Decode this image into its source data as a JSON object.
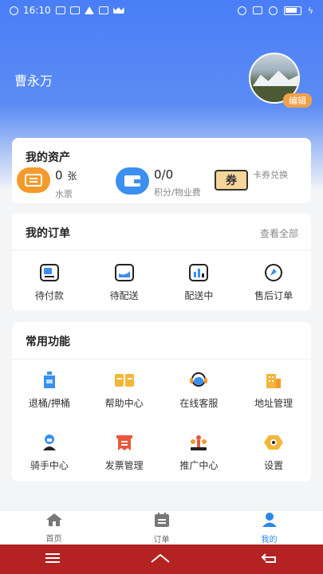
{
  "status_bar": {
    "time": "16:10",
    "battery_level": 0.7
  },
  "profile": {
    "name": "曹永万",
    "edit_label": "编辑"
  },
  "assets": {
    "title": "我的资产",
    "water": {
      "value": "0",
      "unit": "张",
      "label": "水票"
    },
    "points": {
      "value": "0/0",
      "label": "积分/物业费"
    },
    "coupon": {
      "glyph": "券",
      "label": "卡券兑换"
    }
  },
  "orders": {
    "title": "我的订单",
    "view_all": "查看全部",
    "items": [
      {
        "label": "待付款",
        "icon": "pending-payment-icon"
      },
      {
        "label": "待配送",
        "icon": "pending-delivery-icon"
      },
      {
        "label": "配送中",
        "icon": "delivering-icon"
      },
      {
        "label": "售后订单",
        "icon": "after-sales-icon"
      }
    ]
  },
  "functions": {
    "title": "常用功能",
    "items": [
      {
        "label": "退桶/押桶",
        "icon": "water-bucket-icon"
      },
      {
        "label": "帮助中心",
        "icon": "help-book-icon"
      },
      {
        "label": "在线客服",
        "icon": "customer-service-icon"
      },
      {
        "label": "地址管理",
        "icon": "address-building-icon"
      },
      {
        "label": "骑手中心",
        "icon": "rider-icon"
      },
      {
        "label": "发票管理",
        "icon": "invoice-icon"
      },
      {
        "label": "推广中心",
        "icon": "promotion-icon"
      },
      {
        "label": "设置",
        "icon": "settings-gear-icon"
      }
    ]
  },
  "tabbar": {
    "items": [
      {
        "label": "首页",
        "icon": "home-icon"
      },
      {
        "label": "订单",
        "icon": "orders-calendar-icon"
      },
      {
        "label": "我的",
        "icon": "me-person-icon",
        "active": true
      }
    ]
  },
  "colors": {
    "accent": "#2d86e6",
    "brand_blue": "#4a7ef6",
    "orange": "#f39a2c",
    "nav_red": "#b42222"
  }
}
